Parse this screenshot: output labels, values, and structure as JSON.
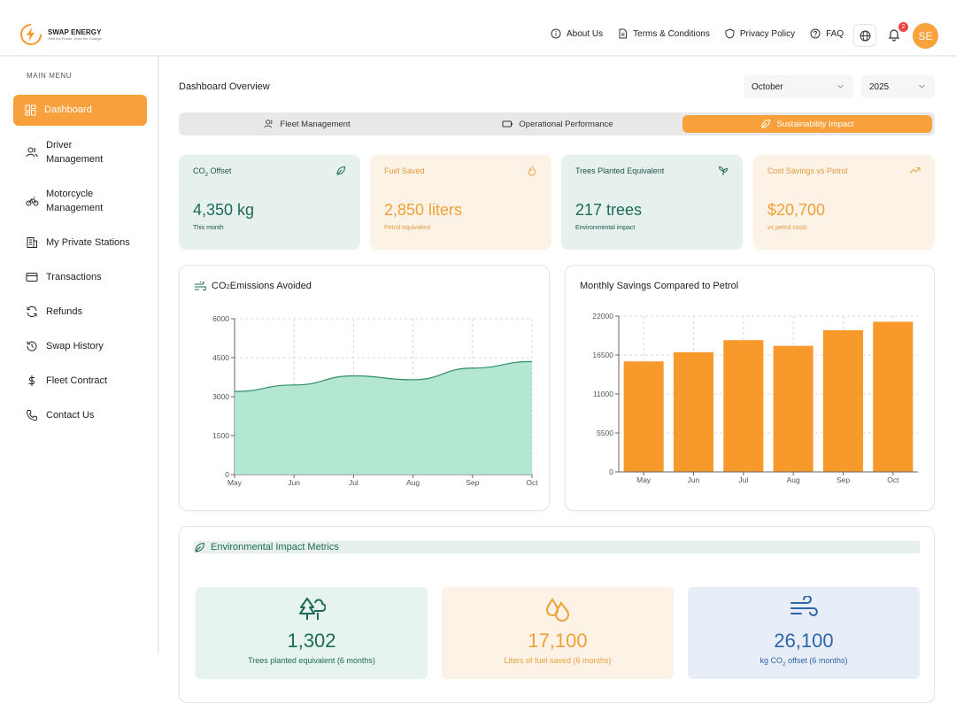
{
  "brand": {
    "name": "SWAP ENERGY",
    "tagline": "Shift the Future. Drive the Change."
  },
  "topnav": [
    {
      "label": "About Us",
      "icon": "info-icon"
    },
    {
      "label": "Terms & Conditions",
      "icon": "document-icon"
    },
    {
      "label": "Privacy Policy",
      "icon": "shield-icon"
    },
    {
      "label": "FAQ",
      "icon": "help-icon"
    }
  ],
  "notifications": {
    "count": "2"
  },
  "user": {
    "initials": "SE"
  },
  "sidebar": {
    "title": "MAIN MENU",
    "items": [
      {
        "label": "Dashboard",
        "icon": "dashboard-grid-icon",
        "active": true
      },
      {
        "label": "Driver\nManagement",
        "icon": "users-icon"
      },
      {
        "label": "Motorcycle\nManagement",
        "icon": "bike-icon"
      },
      {
        "label": "My Private Stations",
        "icon": "building-icon"
      },
      {
        "label": "Transactions",
        "icon": "card-icon"
      },
      {
        "label": "Refunds",
        "icon": "refresh-icon"
      },
      {
        "label": "Swap History",
        "icon": "history-icon"
      },
      {
        "label": "Fleet Contract",
        "icon": "dollar-icon"
      },
      {
        "label": "Contact Us",
        "icon": "phone-icon"
      }
    ]
  },
  "main": {
    "title": "Dashboard Overview",
    "month": "October",
    "year": "2025",
    "tabs": [
      {
        "label": "Fleet Management",
        "icon": "users-icon"
      },
      {
        "label": "Operational Performance",
        "icon": "battery-icon"
      },
      {
        "label": "Sustainability Impact",
        "icon": "leaf-icon",
        "active": true
      }
    ]
  },
  "stats": [
    {
      "label_main": "CO",
      "label_sub": "2",
      "label_rest": " Offset",
      "value": "4,350 kg",
      "sub": "This month",
      "icon": "leaf-icon"
    },
    {
      "label_main": "Fuel Saved",
      "label_sub": "",
      "label_rest": "",
      "value": "2,850 liters",
      "sub": "Petrol equivalent",
      "icon": "flame-icon"
    },
    {
      "label_main": "Trees Planted Equivalent",
      "label_sub": "",
      "label_rest": "",
      "value": "217 trees",
      "sub": "Environmental impact",
      "icon": "sprout-icon"
    },
    {
      "label_main": "Cost Savings vs Petrol",
      "label_sub": "",
      "label_rest": "",
      "value": "$20,700",
      "sub": "vs petrol costs",
      "icon": "trend-up-icon"
    }
  ],
  "charts_text": {
    "co2_title_main": "CO",
    "co2_title_sub": "2",
    "co2_title_rest": " Emissions Avoided",
    "savings_title": "Monthly Savings Compared to Petrol"
  },
  "chart_data": [
    {
      "type": "area",
      "title": "CO₂ Emissions Avoided",
      "categories": [
        "May",
        "Jun",
        "Jul",
        "Aug",
        "Sep",
        "Oct"
      ],
      "values": [
        3200,
        3450,
        3800,
        3650,
        4100,
        4350
      ],
      "yticks": [
        0,
        1500,
        3000,
        4500,
        6000
      ],
      "ylim": [
        0,
        6000
      ],
      "grid": true,
      "color": "#a7e3c9",
      "line_color": "#2f8f6a"
    },
    {
      "type": "bar",
      "title": "Monthly Savings Compared to Petrol",
      "categories": [
        "May",
        "Jun",
        "Jul",
        "Aug",
        "Sep",
        "Oct"
      ],
      "values": [
        15600,
        16900,
        18600,
        17800,
        20000,
        21200
      ],
      "yticks": [
        0,
        5500,
        11000,
        16500,
        22000
      ],
      "ylim": [
        0,
        22000
      ],
      "grid": true,
      "color": "#f7992b"
    }
  ],
  "environment": {
    "title": "Environmental Impact Metrics",
    "boxes": [
      {
        "value": "1,302",
        "label_main": "Trees planted equivalent (6 months)",
        "label_sub": "",
        "label_rest": "",
        "icon": "trees-icon"
      },
      {
        "value": "17,100",
        "label_main": "Liters of fuel saved (6 months)",
        "label_sub": "",
        "label_rest": "",
        "icon": "droplets-icon"
      },
      {
        "value": "26,100",
        "label_main": "kg CO",
        "label_sub": "2",
        "label_rest": " offset (6 months)",
        "icon": "wind-icon"
      }
    ]
  },
  "colors": {
    "accent": "#f8a13c",
    "green": "#1d6b55",
    "orange": "#f0a038",
    "blue": "#2e64a8"
  }
}
